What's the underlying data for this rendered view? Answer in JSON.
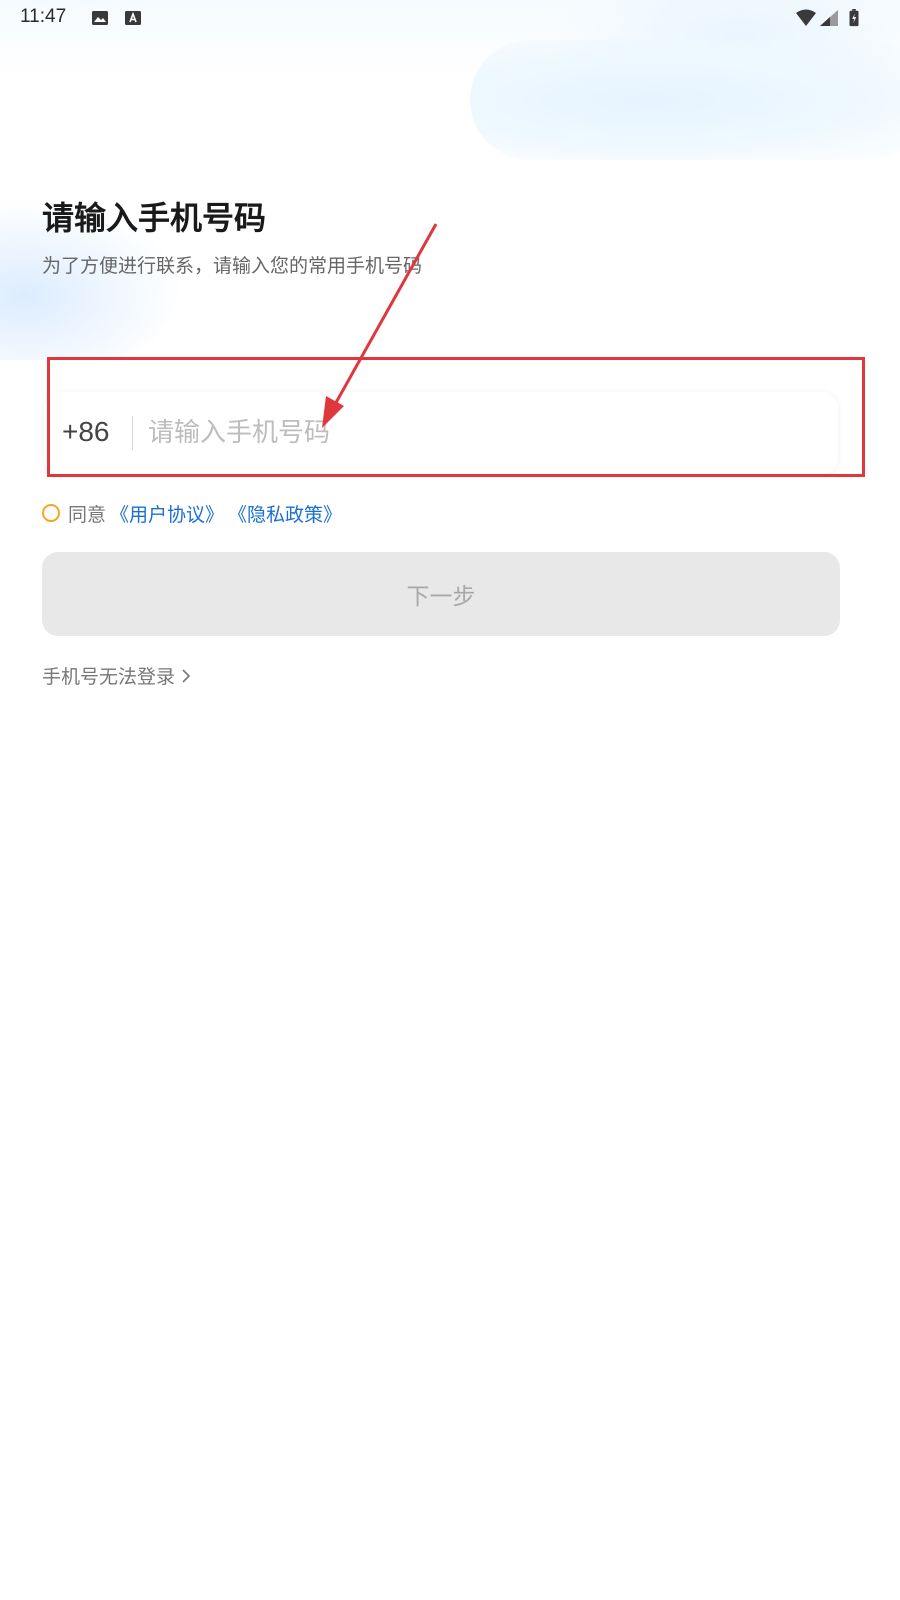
{
  "status_bar": {
    "time": "11:47",
    "icons": [
      "image-icon",
      "text-a-icon",
      "wifi-icon",
      "cellular-signal-icon",
      "battery-icon"
    ]
  },
  "header": {
    "title": "请输入手机号码",
    "subtitle": "为了方便进行联系，请输入您的常用手机号码"
  },
  "phone_form": {
    "country_code": "+86",
    "placeholder": "请输入手机号码",
    "value": ""
  },
  "agreement": {
    "checked": false,
    "prefix": "同意",
    "user_agreement": "《用户协议》",
    "privacy_policy": "《隐私政策》",
    "link_color": "#1a6fd4",
    "radio_color": "#f5a623"
  },
  "next_button": {
    "label": "下一步",
    "enabled": false
  },
  "cannot_login": {
    "label": "手机号无法登录"
  },
  "annotation": {
    "color": "#e0373d"
  }
}
